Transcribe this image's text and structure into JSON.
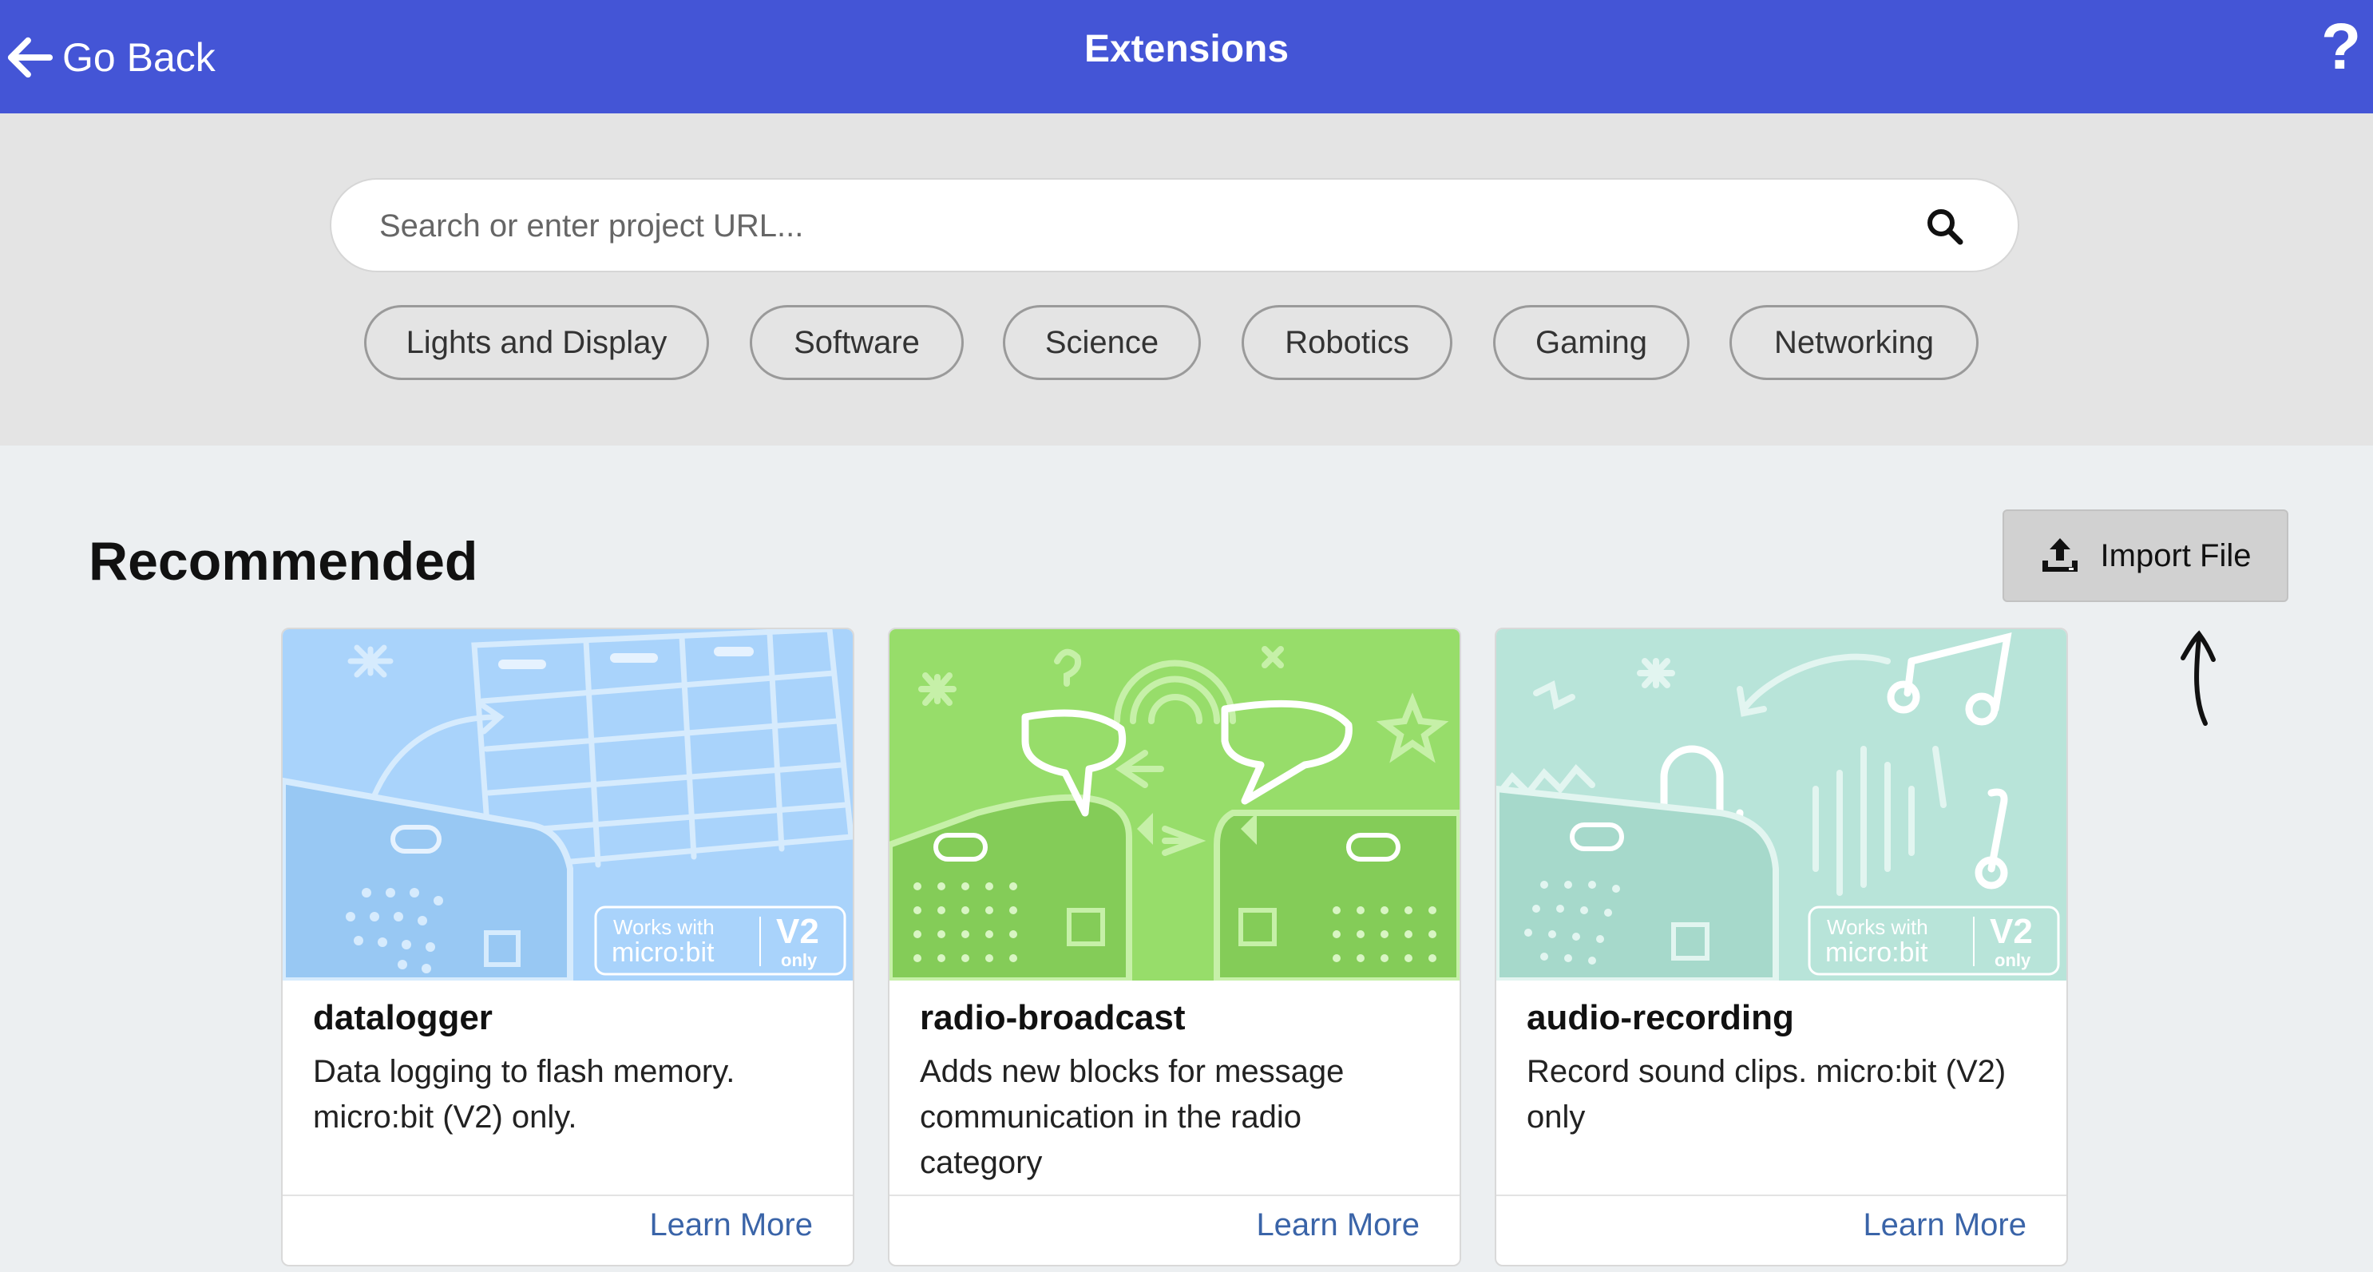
{
  "header": {
    "back_label": "Go Back",
    "title": "Extensions",
    "help_label": "?",
    "background": "#4455d6"
  },
  "search": {
    "placeholder": "Search or enter project URL...",
    "icon": "search-icon"
  },
  "categories": [
    "Lights and Display",
    "Software",
    "Science",
    "Robotics",
    "Gaming",
    "Networking"
  ],
  "recommended": {
    "heading": "Recommended",
    "import_label": "Import File",
    "import_icon": "upload-icon"
  },
  "cards": [
    {
      "name": "datalogger",
      "description": "Data logging to flash memory. micro:bit (V2) only.",
      "learn_more": "Learn More",
      "badge": {
        "line1": "Works with",
        "line2": "micro:bit",
        "version": "V2",
        "note": "only"
      },
      "art_color": "#a9d3fb"
    },
    {
      "name": "radio-broadcast",
      "description": "Adds new blocks for message communication in the radio category",
      "learn_more": "Learn More",
      "art_color": "#97dd6a"
    },
    {
      "name": "audio-recording",
      "description": "Record sound clips. micro:bit (V2) only",
      "learn_more": "Learn More",
      "badge": {
        "line1": "Works with",
        "line2": "micro:bit",
        "version": "V2",
        "note": "only"
      },
      "art_color": "#b8e4d9"
    }
  ]
}
